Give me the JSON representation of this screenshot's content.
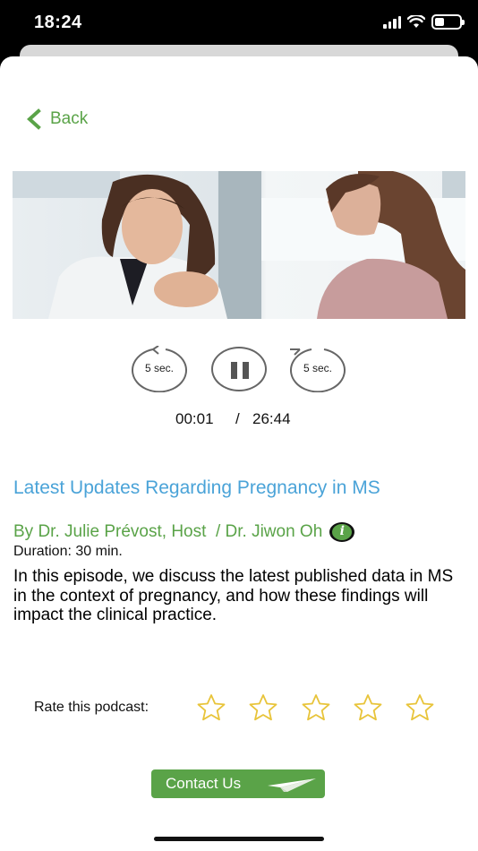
{
  "status_bar": {
    "time": "18:24"
  },
  "nav": {
    "back_label": "Back"
  },
  "player": {
    "rewind_label": "5 sec.",
    "forward_label": "5 sec.",
    "current_time": "00:01",
    "separator": "/",
    "total_time": "26:44"
  },
  "episode": {
    "title": "Latest Updates Regarding Pregnancy in MS",
    "hosts": "By Dr. Julie Prévost, Host  / Dr. Jiwon Oh",
    "duration": "Duration: 30 min.",
    "description": "In this episode, we discuss the latest published data in MS in the context of pregnancy, and how these findings will impact the clinical practice."
  },
  "rating": {
    "label": "Rate this podcast:",
    "stars_total": 5,
    "stars_selected": 0
  },
  "contact": {
    "label": "Contact Us"
  },
  "icons": {
    "back": "chevron-left-icon",
    "rewind": "rewind-5-icon",
    "pause": "pause-icon",
    "forward": "forward-5-icon",
    "info": "info-icon",
    "star": "star-outline-icon",
    "contact": "paper-plane-icon"
  },
  "colors": {
    "accent_green": "#5aa348",
    "title_blue": "#4aa3d8",
    "star_yellow": "#e8c43a"
  }
}
